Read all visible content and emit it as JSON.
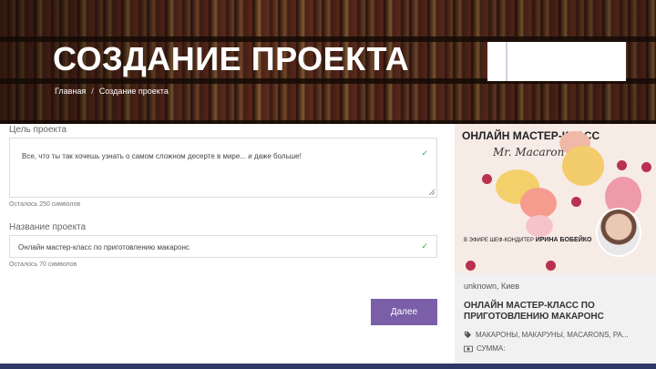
{
  "hero": {
    "title": "СОЗДАНИЕ ПРОЕКТА",
    "breadcrumb": {
      "home": "Главная",
      "separator": "/",
      "current": "Создание проекта"
    }
  },
  "form": {
    "goal": {
      "label": "Цель проекта",
      "value": "Все, что ты так хочешь узнать о самом сложном десерте в мире... и даже больше!",
      "hint": "Осталось 250 символов"
    },
    "name": {
      "label": "Название проекта",
      "value": "Онлайн мастер-класс по приготовлению макаронс",
      "hint": "Осталось 70 символов"
    },
    "next_label": "Далее"
  },
  "card": {
    "image": {
      "line1": "ОНЛАЙН МАСТЕР-КЛАСС",
      "line2": "Mr. Macaron",
      "line3_prefix": "В ЭФИРЕ ШЕФ-КОНДИТЕР",
      "line3_name": "ИРИНА БОБЕЙКО"
    },
    "meta": "unknown, Киев",
    "title": "ОНЛАЙН МАСТЕР-КЛАСС ПО ПРИГОТОВЛЕНИЮ МАКАРОНС",
    "tags": "МАКАРОНЫ, МАКАРУНЫ, MACARONS, PA...",
    "sum": "СУММА:"
  },
  "colors": {
    "accent": "#7a5fa8",
    "check": "#3fa33f",
    "bottom_bar": "#2d3868"
  },
  "icons": {
    "goal_check": "check-icon",
    "name_check": "check-icon",
    "tags": "tag-icon",
    "sum": "money-icon"
  }
}
